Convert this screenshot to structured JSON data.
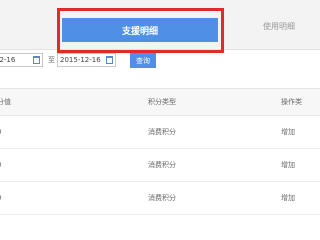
{
  "tabs": {
    "active_label": "支援明细",
    "other_label": "使用明细"
  },
  "filter": {
    "start_date": "12-16",
    "separator": "至",
    "end_date": "2015-12-16",
    "query_label": "查询"
  },
  "table": {
    "headers": [
      "分值",
      "积分类型",
      "操作类"
    ],
    "rows": [
      {
        "c1": "0",
        "c2": "消费积分",
        "c3": "增加"
      },
      {
        "c1": "0",
        "c2": "消费积分",
        "c3": "增加"
      },
      {
        "c1": "0",
        "c2": "消费积分",
        "c3": "增加"
      }
    ]
  },
  "colors": {
    "accent": "#4f8fe6",
    "highlight_border": "#e02b2b"
  }
}
